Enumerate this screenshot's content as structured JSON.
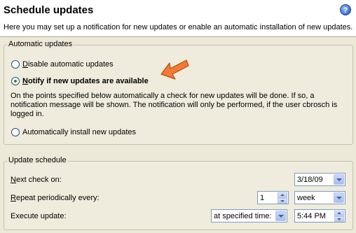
{
  "header": {
    "title": "Schedule updates",
    "help_icon": "help-icon",
    "help_glyph": "?",
    "description": "Here you may set up a notification for new updates or enable an automatic installation of new updates."
  },
  "automatic_updates": {
    "group_label": "Automatic updates",
    "options": [
      {
        "mnemonic": "D",
        "rest": "isable automatic updates",
        "checked": false
      },
      {
        "mnemonic": "N",
        "rest": "otify if new updates are available",
        "checked": true
      },
      {
        "mnemonic": "",
        "rest": "Automatically install new updates",
        "checked": false
      }
    ],
    "info_text": "On the points specified below automatically a check for new updates will be done. If so, a notification message will be shown. The notification will only be performed, if the user cbrosch is logged in.",
    "annotation_arrow_color": "#f57a33"
  },
  "update_schedule": {
    "group_label": "Update schedule",
    "next_check": {
      "mnemonic": "N",
      "rest": "ext check on:",
      "value": "3/18/09"
    },
    "repeat": {
      "mnemonic": "R",
      "rest": "epeat periodically every:",
      "count": "1",
      "unit": "week"
    },
    "execute": {
      "label": "Execute update:",
      "mode": "at specified time:",
      "time": "5:44 PM"
    }
  }
}
